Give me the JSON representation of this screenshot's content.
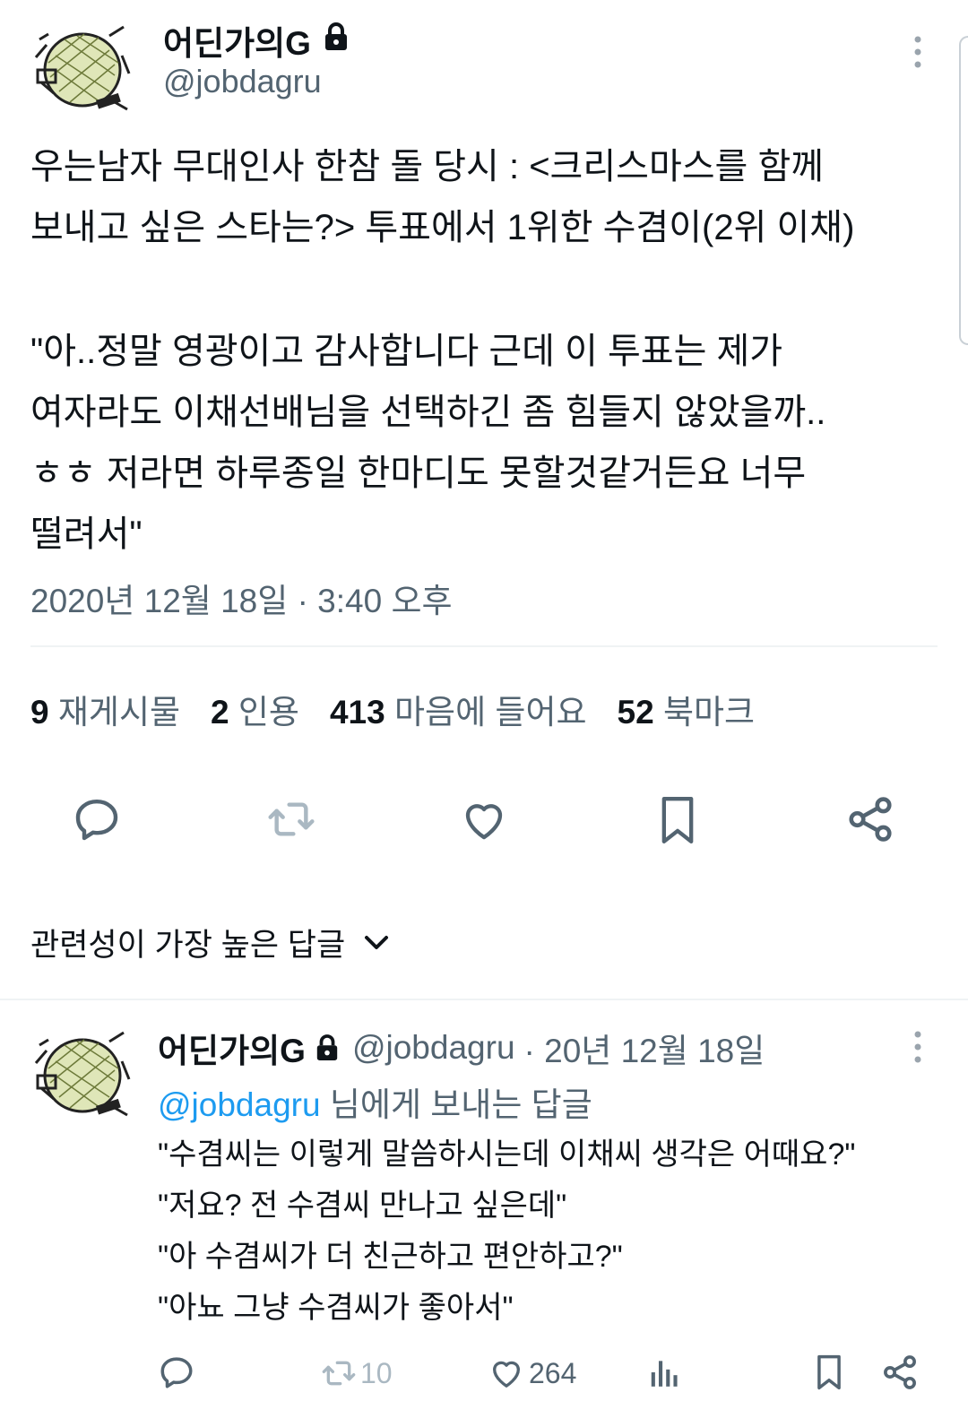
{
  "tweet": {
    "author": {
      "name": "어딘가의G",
      "handle": "@jobdagru"
    },
    "text_lines": [
      "우는남자 무대인사 한참 돌 당시 : <크리스마스를 함께",
      "보내고 싶은 스타는?> 투표에서 1위한 수겸이(2위 이채)",
      "\"아..정말 영광이고 감사합니다 근데 이 투표는 제가",
      "여자라도 이채선배님을 선택하긴 좀 힘들지 않았을까..",
      "ㅎㅎ 저라면 하루종일 한마디도 못할것같거든요 너무",
      "떨려서\""
    ],
    "timestamp": "2020년 12월 18일 · 3:40 오후",
    "stats": [
      {
        "count": "9",
        "label": "재게시물"
      },
      {
        "count": "2",
        "label": "인용"
      },
      {
        "count": "413",
        "label": "마음에 들어요"
      },
      {
        "count": "52",
        "label": "북마크"
      }
    ],
    "actions": [
      "reply-icon",
      "retweet-icon",
      "heart-icon",
      "bookmark-icon",
      "share-icon"
    ]
  },
  "sort": {
    "label": "관련성이 가장 높은 답글"
  },
  "reply": {
    "author": {
      "name": "어딘가의G",
      "handle": "@jobdagru",
      "meta": "· 20년 12월 18일"
    },
    "replying_to_handle": "@jobdagru",
    "replying_to_suffix": "님에게 보내는 답글",
    "text_lines": [
      "\"수겸씨는 이렇게 말씀하시는데 이채씨 생각은 어때요?\"",
      "\"저요? 전 수겸씨 만나고 싶은데\"",
      "\"아 수겸씨가 더 친근하고 편안하고?\"",
      "\"아뇨 그냥 수겸씨가 좋아서\""
    ],
    "retweets": "10",
    "likes": "264"
  },
  "colors": {
    "text": "#0f1419",
    "muted": "#536471",
    "link": "#1d9bf0",
    "divider": "#eff3f4",
    "retweet_disabled": "#aab8c2"
  }
}
